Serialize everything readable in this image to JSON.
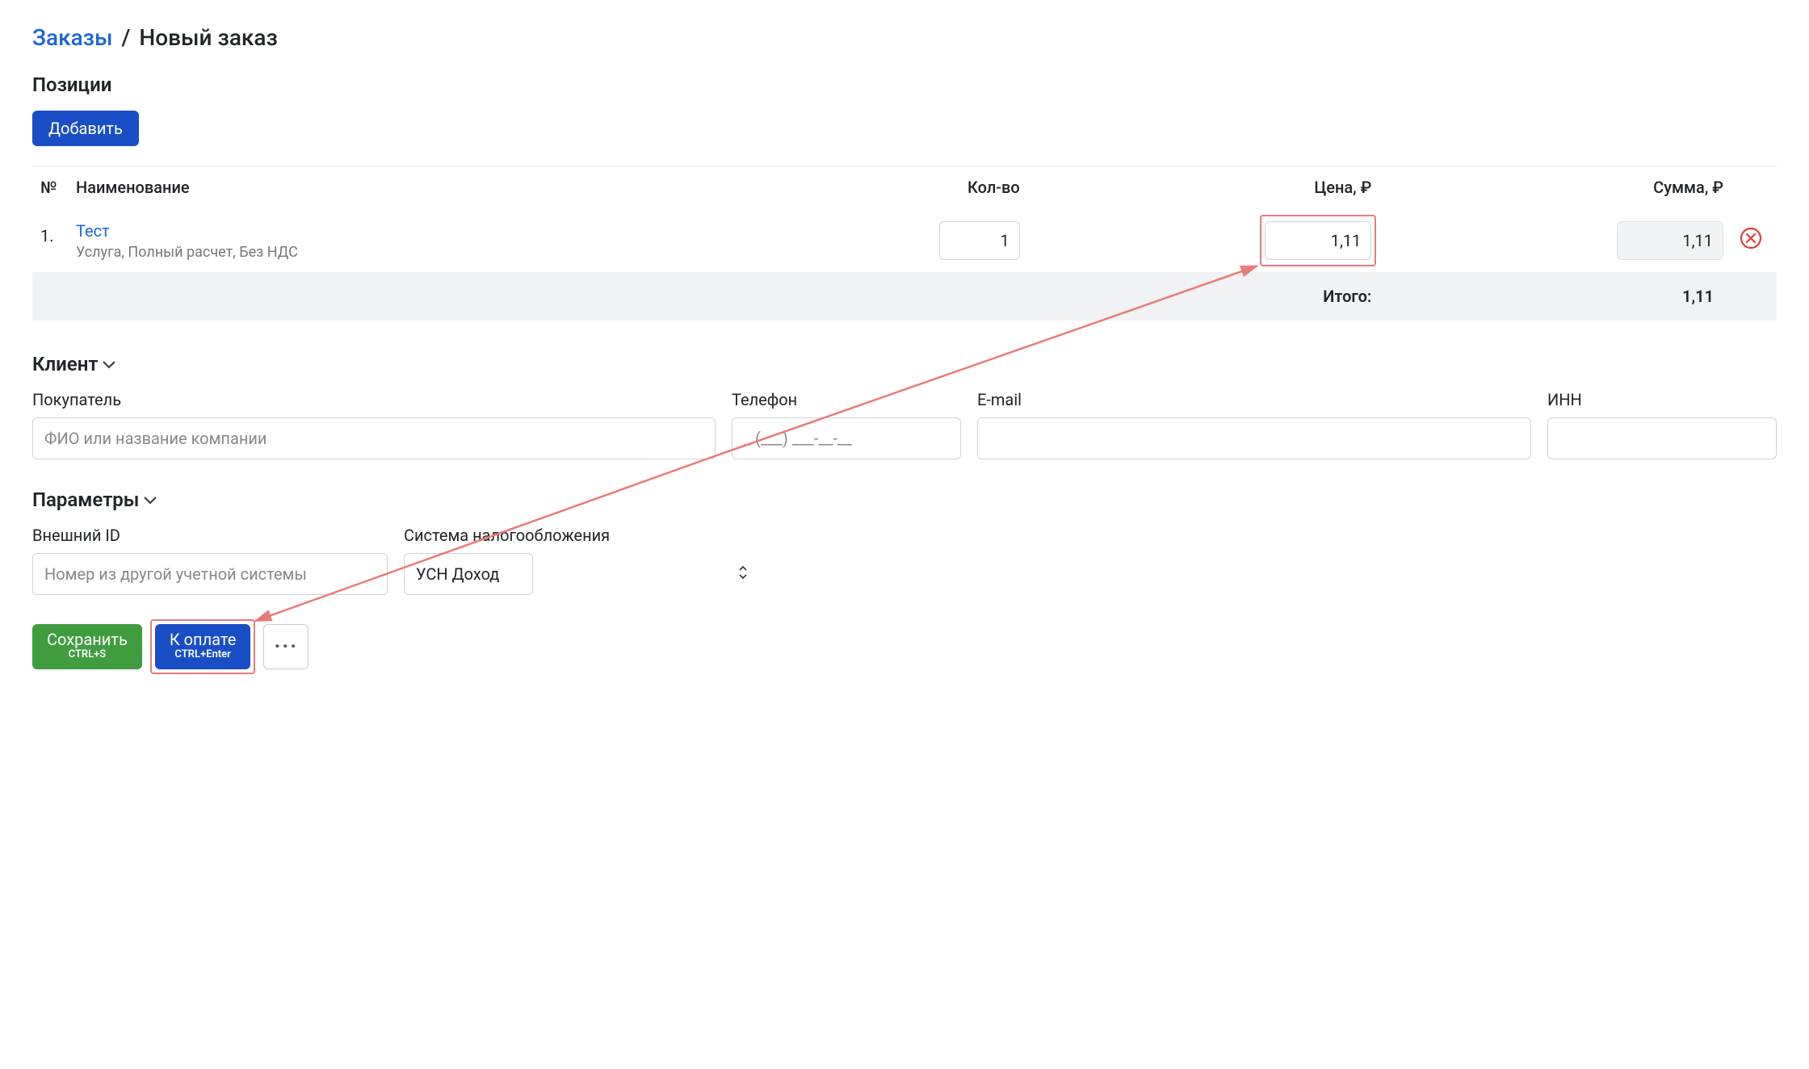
{
  "breadcrumb": {
    "orders_link": "Заказы",
    "current": "Новый заказ"
  },
  "positions": {
    "title": "Позиции",
    "add_button": "Добавить",
    "columns": {
      "index": "№",
      "name": "Наименование",
      "qty": "Кол-во",
      "price": "Цена, ₽",
      "sum": "Сумма, ₽"
    },
    "row": {
      "index": "1.",
      "name": "Тест",
      "meta": "Услуга, Полный расчет, Без НДС",
      "qty": "1",
      "price": "1,11",
      "sum": "1,11"
    },
    "total_label": "Итого:",
    "total_value": "1,11"
  },
  "client": {
    "title": "Клиент",
    "buyer_label": "Покупатель",
    "buyer_placeholder": "ФИО или название компании",
    "phone_label": "Телефон",
    "phone_placeholder": "_ (___) ___-__-__",
    "email_label": "E-mail",
    "inn_label": "ИНН"
  },
  "params": {
    "title": "Параметры",
    "extid_label": "Внешний ID",
    "extid_placeholder": "Номер из другой учетной системы",
    "tax_label": "Система налогообложения",
    "tax_value": "УСН Доход"
  },
  "actions": {
    "save_label": "Сохранить",
    "save_shortcut": "CTRL+S",
    "pay_label": "К оплате",
    "pay_shortcut": "CTRL+Enter",
    "more": "···"
  }
}
